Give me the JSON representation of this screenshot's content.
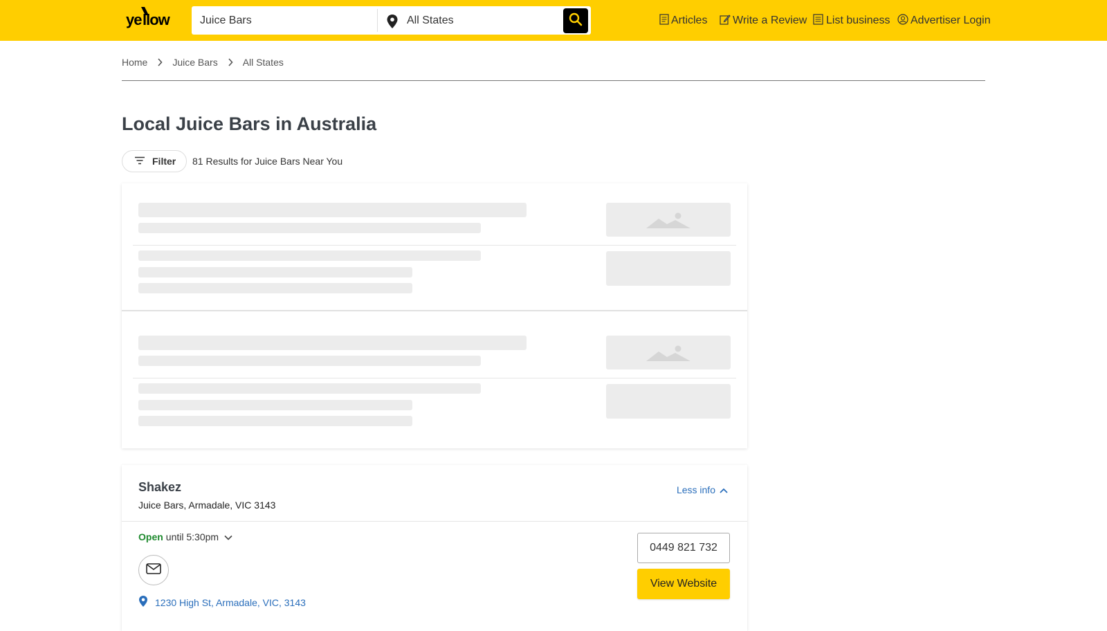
{
  "header": {
    "logo_alt": "yellow",
    "search_what": "Juice Bars",
    "search_where": "All States",
    "nav": [
      {
        "label": "Articles",
        "icon": "articles-icon"
      },
      {
        "label": "Write a Review",
        "icon": "edit-icon"
      },
      {
        "label": "List business",
        "icon": "list-business-icon"
      },
      {
        "label": "Advertiser Login",
        "icon": "user-icon"
      }
    ]
  },
  "breadcrumb": [
    "Home",
    "Juice Bars",
    "All States"
  ],
  "page": {
    "title": "Local Juice Bars in Australia",
    "filter_label": "Filter",
    "results_text": "81 Results for Juice Bars Near You"
  },
  "listing": {
    "name": "Shakez",
    "subtitle": "Juice Bars, Armadale, VIC 3143",
    "less_info": "Less info",
    "open_status": "Open",
    "open_hours": "until 5:30pm",
    "address": "1230 High St, Armadale, VIC, 3143",
    "phone": "0449 821 732",
    "website_label": "View Website"
  },
  "colors": {
    "brand_yellow": "#ffce00",
    "link_blue": "#2a6ebb",
    "open_green": "#1e8a2e",
    "skeleton_grey": "#ececec"
  }
}
